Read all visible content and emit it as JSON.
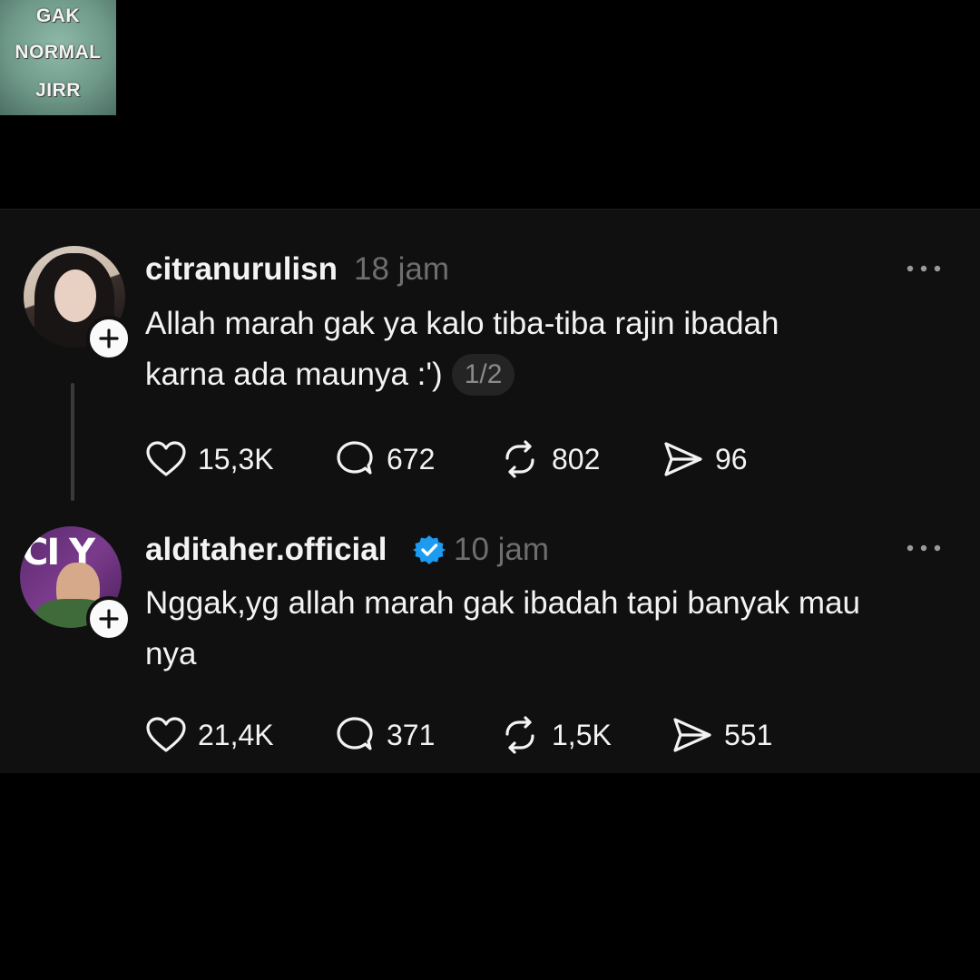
{
  "watermark": {
    "lines": [
      "GAK",
      "NORMAL",
      "JIRR"
    ]
  },
  "posts": [
    {
      "username": "citranurulisn",
      "time": "18 jam",
      "verified": false,
      "text_line1": "Allah marah gak ya kalo tiba-tiba rajin ibadah",
      "text_line2": "karna ada maunya :')",
      "page_indicator": "1/2",
      "likes": "15,3K",
      "replies": "672",
      "reposts": "802",
      "shares": "96"
    },
    {
      "username": "alditaher.official",
      "time": "10 jam",
      "verified": true,
      "avatar_text": "CI Y",
      "text_line1": "Nggak,yg allah marah gak ibadah tapi banyak mau",
      "text_line2": "nya",
      "likes": "21,4K",
      "replies": "371",
      "reposts": "1,5K",
      "shares": "551"
    }
  ],
  "colors": {
    "background": "#000000",
    "panel": "#101010",
    "text": "#f3f3f3",
    "muted": "#6e6e6e",
    "verified": "#1d9bf0"
  }
}
